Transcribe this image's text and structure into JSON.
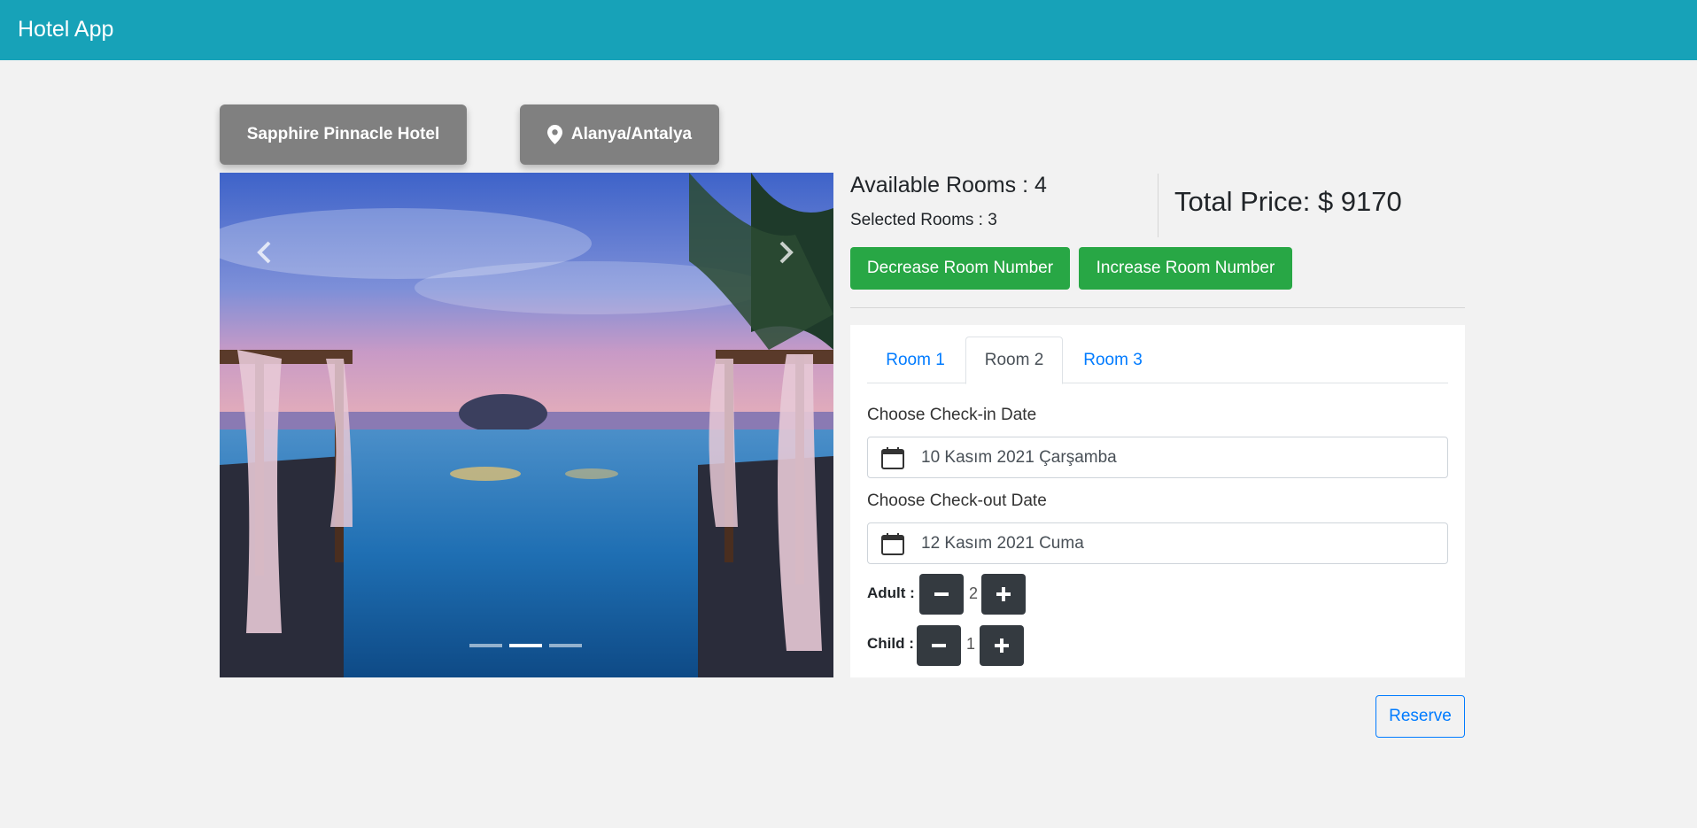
{
  "app": {
    "title": "Hotel App"
  },
  "hotel": {
    "name": "Sapphire Pinnacle Hotel",
    "location": "Alanya/Antalya"
  },
  "carousel": {
    "slide_count": 3,
    "active_slide": 2,
    "image_description": "infinity pool with cabanas at sunset"
  },
  "rooms": {
    "available_label": "Available Rooms : 4",
    "selected_label": "Selected Rooms : 3",
    "total_price_label": "Total Price: $ 9170",
    "decrease_label": "Decrease Room Number",
    "increase_label": "Increase Room Number"
  },
  "tabs": [
    {
      "label": "Room 1",
      "active": false
    },
    {
      "label": "Room 2",
      "active": true
    },
    {
      "label": "Room 3",
      "active": false
    }
  ],
  "booking": {
    "checkin_label": "Choose Check-in Date",
    "checkin_value": "10 Kasım 2021 Çarşamba",
    "checkout_label": "Choose Check-out Date",
    "checkout_value": "12 Kasım 2021 Cuma",
    "adult_label": "Adult :",
    "adult_value": "2",
    "child_label": "Child :",
    "child_value": "1"
  },
  "actions": {
    "reserve_label": "Reserve"
  },
  "colors": {
    "navbar": "#17a2b8",
    "success": "#28a745",
    "primary": "#007bff",
    "dark": "#343a40",
    "pill": "#808080"
  }
}
